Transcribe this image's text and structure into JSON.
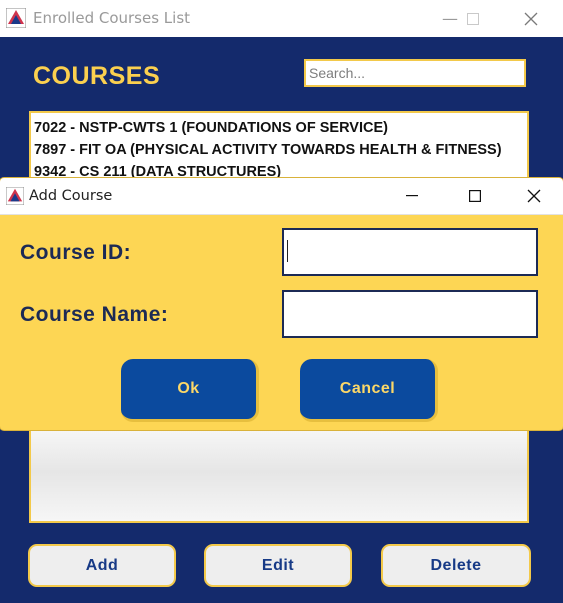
{
  "main_window": {
    "title": "Enrolled Courses List",
    "controls": {
      "minimize": "—",
      "maximize": "☐",
      "close": "✕"
    },
    "heading": "COURSES",
    "search": {
      "placeholder": "Search...",
      "value": ""
    },
    "courses": [
      "7022 - NSTP-CWTS 1 (FOUNDATIONS OF SERVICE)",
      "7897 - FIT OA (PHYSICAL ACTIVITY TOWARDS HEALTH & FITNESS)",
      "9342 - CS 211 (DATA STRUCTURES)"
    ],
    "buttons": {
      "add": "Add",
      "edit": "Edit",
      "delete": "Delete"
    }
  },
  "dialog": {
    "title": "Add Course",
    "controls": {
      "minimize": "—",
      "maximize": "☐",
      "close": "✕"
    },
    "fields": {
      "course_id": {
        "label": "Course ID:",
        "value": ""
      },
      "course_name": {
        "label": "Course Name:",
        "value": ""
      }
    },
    "buttons": {
      "ok": "Ok",
      "cancel": "Cancel"
    }
  },
  "colors": {
    "navy_background": "#142a6c",
    "gold_accent": "#fbd04f",
    "dialog_background": "#fdd654",
    "dialog_button": "#0b4a9e",
    "button_text": "#173a86"
  }
}
